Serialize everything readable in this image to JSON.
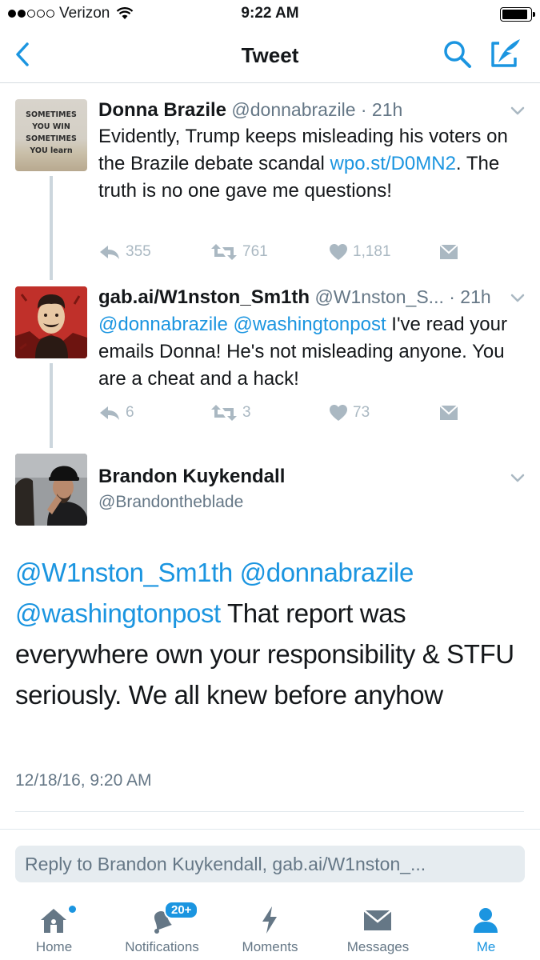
{
  "status_bar": {
    "carrier": "Verizon",
    "time": "9:22 AM",
    "signal_bars_filled": 2,
    "signal_bars_total": 5
  },
  "nav": {
    "title": "Tweet",
    "back_icon": "chevron-left-icon",
    "search_icon": "search-icon",
    "compose_icon": "compose-icon"
  },
  "thread": [
    {
      "name": "Donna Brazile",
      "handle": "@donnabrazile",
      "time": "· 21h",
      "text_before": "Evidently, Trump keeps misleading his voters on the Brazile debate scandal ",
      "link": "wpo.st/D0MN2",
      "text_after": ". The truth is no one gave me questions!",
      "avatar_lines": [
        "SOMETIMES",
        "YOU WIN",
        "SOMETIMES",
        "YOU learn"
      ],
      "replies": "355",
      "retweets": "761",
      "likes": "1,181"
    },
    {
      "name": "gab.ai/W1nston_Sm1th",
      "handle": "@W1nston_S...",
      "time": "· 21h",
      "mention_1": "@donnabrazile",
      "mention_2": "@washingtonpost",
      "text": " I've read your emails Donna! He's not misleading anyone. You are a cheat and a hack!",
      "replies": "6",
      "retweets": "3",
      "likes": "73"
    }
  ],
  "main_tweet": {
    "name": "Brandon Kuykendall",
    "handle": "@Brandontheblade",
    "mention_1": "@W1nston_Sm1th",
    "mention_2": "@donnabrazile",
    "mention_3": "@washingtonpost",
    "text": " That report was everywhere own your responsibility & STFU seriously. We all knew before anyhow",
    "timestamp": "12/18/16, 9:20 AM"
  },
  "reply_box": {
    "placeholder": "Reply to Brandon Kuykendall, gab.ai/W1nston_..."
  },
  "tab_bar": {
    "tabs": [
      {
        "label": "Home",
        "icon": "home-icon"
      },
      {
        "label": "Notifications",
        "icon": "bell-icon",
        "badge": "20+"
      },
      {
        "label": "Moments",
        "icon": "lightning-icon"
      },
      {
        "label": "Messages",
        "icon": "envelope-icon"
      },
      {
        "label": "Me",
        "icon": "person-icon"
      }
    ],
    "active_tab": "Me"
  },
  "colors": {
    "accent": "#1b95e0",
    "text": "#14171a",
    "muted": "#657786",
    "action_gray": "#aab8c2"
  }
}
